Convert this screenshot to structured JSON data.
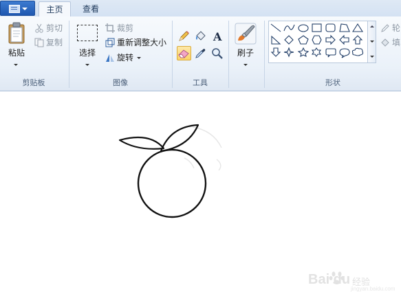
{
  "tabs": {
    "file_icon": "document-menu-icon",
    "home": "主页",
    "view": "查看"
  },
  "clipboard": {
    "paste": "粘贴",
    "cut": "剪切",
    "copy": "复制",
    "group": "剪贴板"
  },
  "image": {
    "select": "选择",
    "crop": "裁剪",
    "resize": "重新调整大小",
    "rotate": "旋转",
    "group": "图像"
  },
  "tools": {
    "group": "工具",
    "items": [
      "pencil-icon",
      "fill-bucket-icon",
      "text-icon",
      "eraser-icon",
      "color-picker-icon",
      "magnifier-icon"
    ],
    "active": "eraser-icon",
    "text_glyph": "A"
  },
  "brushes": {
    "label": "刷子"
  },
  "shapes": {
    "group": "形状",
    "outline": "轮",
    "fill": "填",
    "items": [
      "line",
      "curve",
      "oval",
      "rectangle",
      "rounded-rectangle",
      "polygon",
      "triangle",
      "right-triangle",
      "diamond",
      "pentagon",
      "hexagon",
      "right-arrow",
      "left-arrow",
      "up-arrow",
      "down-arrow",
      "four-point-star",
      "five-point-star",
      "six-point-star",
      "rounded-callout",
      "oval-callout",
      "cloud-callout"
    ]
  },
  "watermark": {
    "brand": "Bai  du",
    "sub": "经验",
    "url": "jingyan.baidu.com"
  },
  "colors": {
    "file_tab": "#2a66c0",
    "ribbon_bg": "#eaf1f9",
    "active_tool": "#fcd36a",
    "stroke": "#111111"
  }
}
